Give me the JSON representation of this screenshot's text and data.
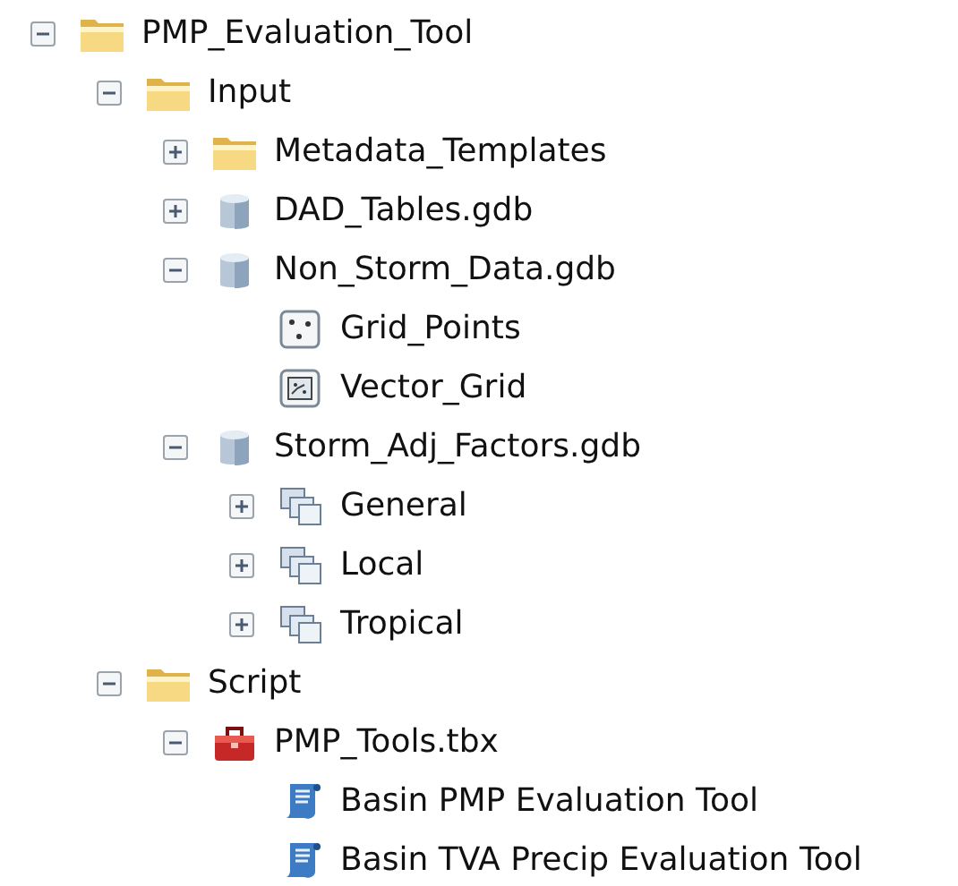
{
  "tree": [
    {
      "label": "PMP_Evaluation_Tool",
      "kind": "folder",
      "expanded": true,
      "children": [
        {
          "label": "Input",
          "kind": "folder",
          "expanded": true,
          "children": [
            {
              "label": "Metadata_Templates",
              "kind": "folder",
              "expanded": false
            },
            {
              "label": "DAD_Tables.gdb",
              "kind": "gdb",
              "expanded": false
            },
            {
              "label": "Non_Storm_Data.gdb",
              "kind": "gdb",
              "expanded": true,
              "children": [
                {
                  "label": "Grid_Points",
                  "kind": "points"
                },
                {
                  "label": "Vector_Grid",
                  "kind": "polygons"
                }
              ]
            },
            {
              "label": "Storm_Adj_Factors.gdb",
              "kind": "gdb",
              "expanded": true,
              "children": [
                {
                  "label": "General",
                  "kind": "dataset",
                  "expanded": false
                },
                {
                  "label": "Local",
                  "kind": "dataset",
                  "expanded": false
                },
                {
                  "label": "Tropical",
                  "kind": "dataset",
                  "expanded": false
                }
              ]
            }
          ]
        },
        {
          "label": "Script",
          "kind": "folder",
          "expanded": true,
          "children": [
            {
              "label": "PMP_Tools.tbx",
              "kind": "toolbox",
              "expanded": true,
              "children": [
                {
                  "label": "Basin PMP Evaluation Tool",
                  "kind": "script"
                },
                {
                  "label": "Basin TVA Precip Evaluation Tool",
                  "kind": "script"
                }
              ]
            }
          ]
        }
      ]
    }
  ]
}
